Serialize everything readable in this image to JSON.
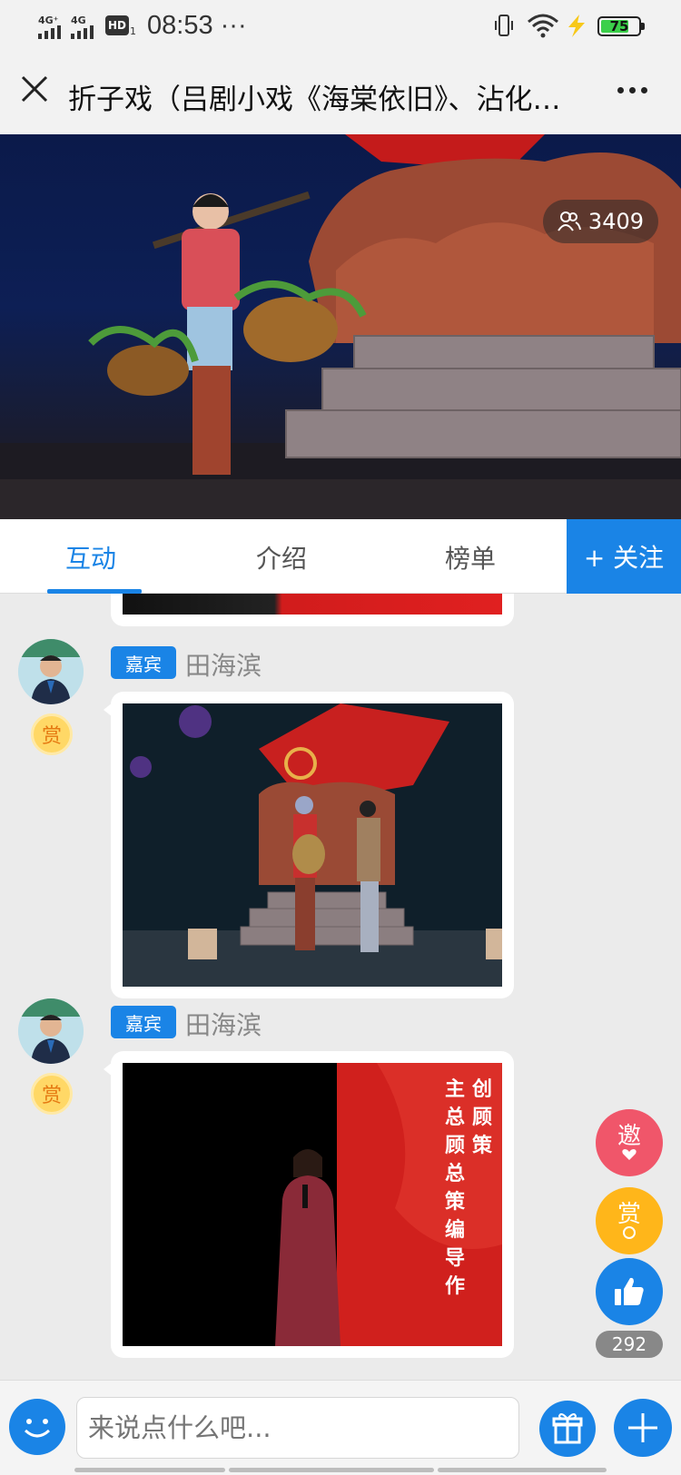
{
  "status_bar": {
    "network_1": "4G⁺",
    "network_2": "4G",
    "hd": "HD",
    "hd_sub": "1",
    "time": "08:53 ···",
    "battery": "75"
  },
  "header": {
    "title": "折子戏（吕剧小戏《海棠依旧》、沾化…"
  },
  "video": {
    "viewer_count": "3409"
  },
  "tabs": [
    {
      "label": "互动"
    },
    {
      "label": "介绍"
    },
    {
      "label": "榜单"
    }
  ],
  "follow_label": "+ 关注",
  "messages": [
    {
      "tag": "嘉宾",
      "author": "田海滨",
      "reward": "赏"
    },
    {
      "tag": "嘉宾",
      "author": "田海滨",
      "reward": "赏"
    }
  ],
  "photo3_text": [
    "主",
    "总",
    "顾",
    "总",
    "策",
    "编",
    "导",
    "作"
  ],
  "photo3_text2": [
    "创",
    "顾",
    "策"
  ],
  "floating": {
    "invite": "邀",
    "reward": "赏",
    "like_count": "292"
  },
  "comment_box": {
    "placeholder": "来说点什么吧..."
  },
  "colors": {
    "accent": "#1a84e6",
    "invite": "#f0566a",
    "reward": "#ffb61a"
  }
}
